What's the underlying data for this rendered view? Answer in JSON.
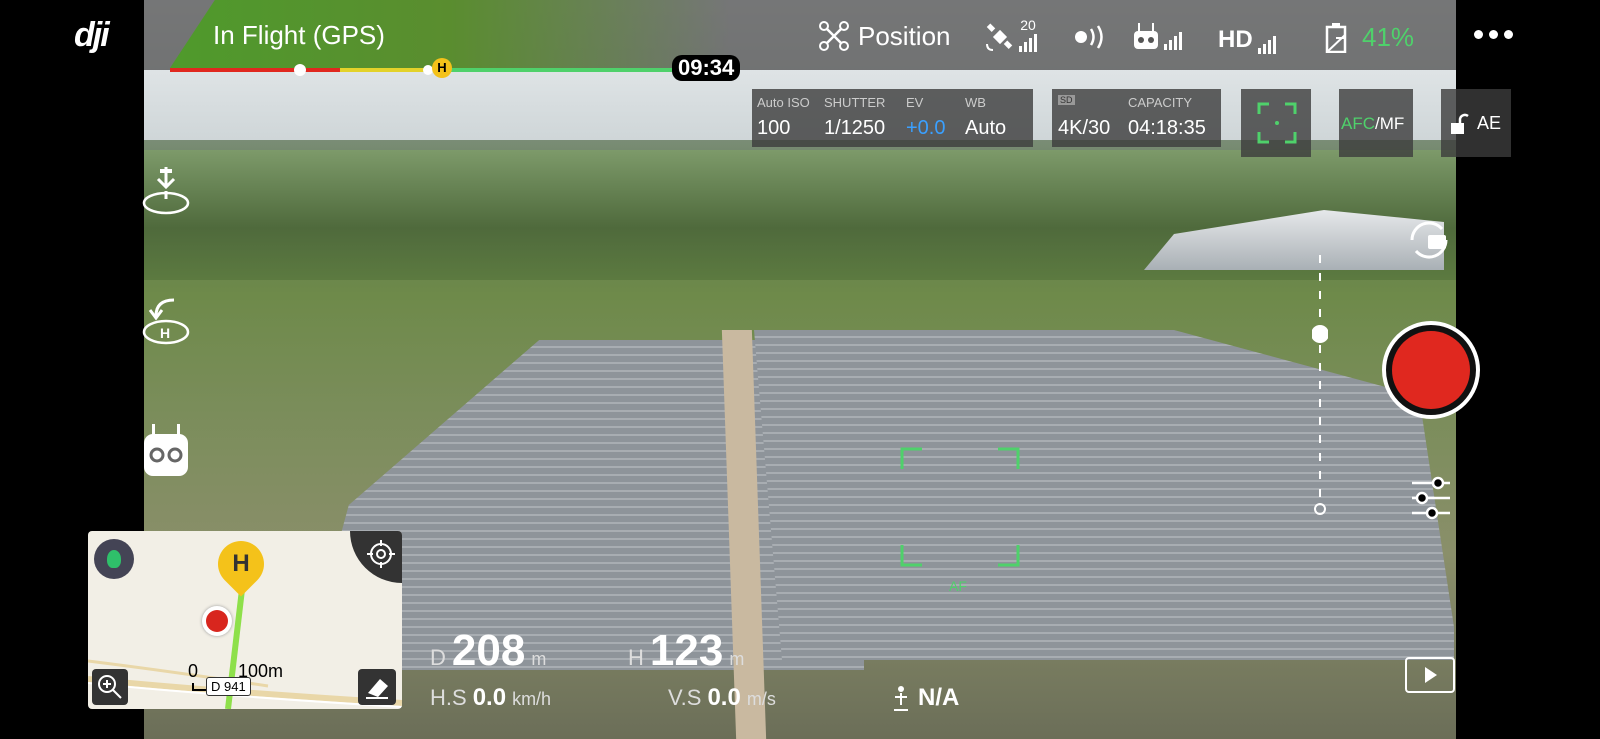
{
  "brand": {
    "logo_text": "dji"
  },
  "status": {
    "flight_mode": "In Flight (GPS)",
    "flight_time": "09:34",
    "home_marker": "H",
    "position_mode": "Position",
    "gps_satellites": "20",
    "video_link": "HD",
    "battery_percent": "41%"
  },
  "camera": {
    "iso_label": "Auto ISO",
    "iso_value": "100",
    "shutter_label": "SHUTTER",
    "shutter_value": "1/1250",
    "ev_label": "EV",
    "ev_value": "+0.0",
    "wb_label": "WB",
    "wb_value": "Auto",
    "sd_label": "SD",
    "capacity_label": "CAPACITY",
    "resolution": "4K/30",
    "capacity_value": "04:18:35",
    "afc_label": "AFC",
    "mf_label": "MF",
    "ae_label": "AE",
    "focus_label": "AF"
  },
  "telemetry": {
    "d_label": "D",
    "d_value": "208",
    "d_unit": "m",
    "h_label": "H",
    "h_value": "123",
    "h_unit": "m",
    "hs_label": "H.S",
    "hs_value": "0.0",
    "hs_unit": "km/h",
    "vs_label": "V.S",
    "vs_value": "0.0",
    "vs_unit": "m/s",
    "vps_value": "N/A"
  },
  "map": {
    "home_marker": "H",
    "scale_zero": "0",
    "scale_max": "100m",
    "distance_tag": "D 941"
  },
  "colors": {
    "accent_green": "#4fd16b",
    "record_red": "#e0281f",
    "ev_blue": "#3aa0ff",
    "status_green": "#4f9a2c"
  }
}
